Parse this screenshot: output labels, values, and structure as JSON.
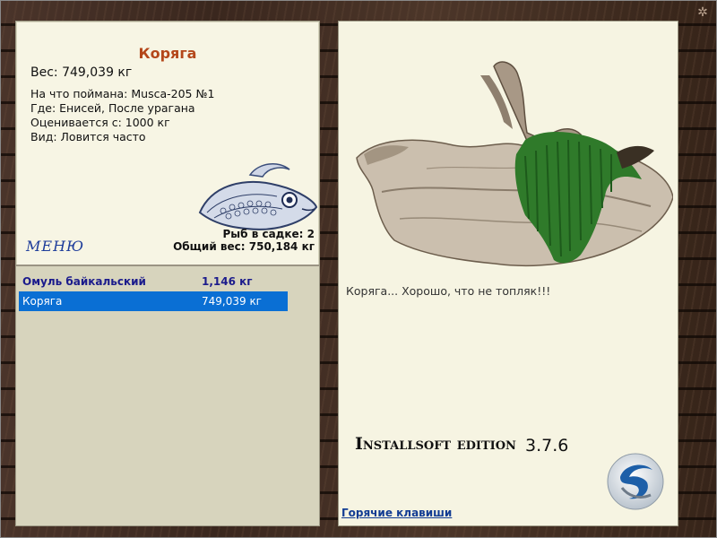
{
  "fish_card": {
    "title": "Коряга",
    "weight": "Вес: 749,039 кг",
    "caught_with": "На что поймана: Musca-205 №1",
    "location": "Где: Енисей, После урагана",
    "valued_from": "Оценивается с: 1000 кг",
    "frequency": "Вид: Ловится часто",
    "menu_label": "МЕНЮ",
    "keepnet_count": "Рыб в садке: 2",
    "total_weight": "Общий вес: 750,184 кг"
  },
  "catch_list": [
    {
      "name": "Омуль байкальский",
      "weight": "1,146 кг"
    },
    {
      "name": "Коряга",
      "weight": "749,039 кг"
    }
  ],
  "right_panel": {
    "comment": "Коряга... Хорошо, что не топляк!!!",
    "edition": "Installsoft edition",
    "version": "3.7.6",
    "hotkeys_link": "Горячие клавиши"
  },
  "colors": {
    "title": "#b4471a",
    "selection": "#0a6fd4",
    "link": "#123c93"
  }
}
